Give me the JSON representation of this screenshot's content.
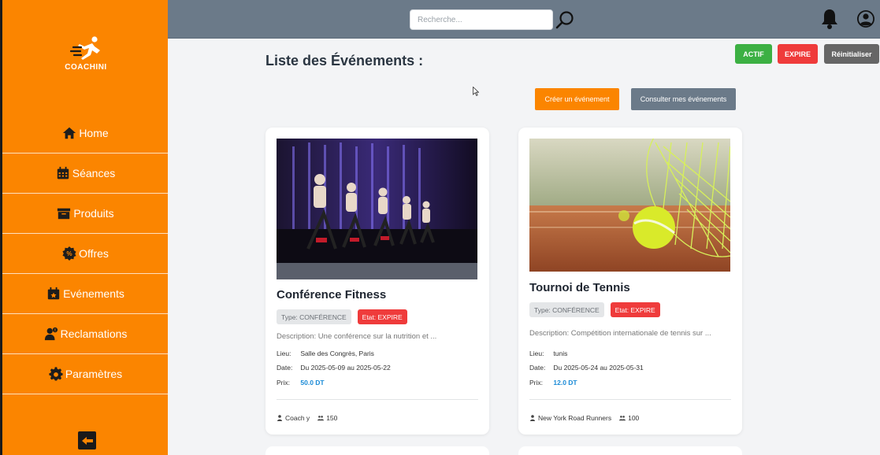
{
  "app": {
    "logo_text": "COACHINI"
  },
  "sidebar": {
    "items": [
      {
        "label": "Home",
        "icon": "home-icon"
      },
      {
        "label": "Séances",
        "icon": "calendar-icon"
      },
      {
        "label": "Produits",
        "icon": "box-icon"
      },
      {
        "label": "Offres",
        "icon": "discount-icon"
      },
      {
        "label": "Evénements",
        "icon": "event-icon"
      },
      {
        "label": "Reclamations",
        "icon": "user-alert-icon"
      },
      {
        "label": "Paramètres",
        "icon": "gear-icon"
      }
    ],
    "logout_icon": "logout-icon"
  },
  "header": {
    "search_placeholder": "Recherche..."
  },
  "main": {
    "title": "Liste des Événements :",
    "filters": {
      "actif": "ACTIF",
      "expire": "EXPIRE",
      "reset": "Réinitialiser"
    },
    "create_button": "Créer un événement",
    "consult_button": "Consulter mes événements",
    "labels": {
      "lieu": "Lieu:",
      "date": "Date:",
      "prix": "Prix:"
    },
    "events": [
      {
        "title": "Conférence Fitness",
        "type": "Type: CONFÉRENCE",
        "etat": "Etat: EXPIRE",
        "description": "Description: Une conférence sur la nutrition et ...",
        "lieu": "Salle des Congrès, Paris",
        "date": "Du 2025-05-09 au 2025-05-22",
        "prix": "50.0 DT",
        "organizer": "Coach y",
        "participants": "150"
      },
      {
        "title": "Tournoi de Tennis",
        "type": "Type: CONFÉRENCE",
        "etat": "Etat: EXPIRE",
        "description": "Description: Compétition internationale de tennis sur ...",
        "lieu": "tunis",
        "date": "Du 2025-05-24 au 2025-05-31",
        "prix": "12.0 DT",
        "organizer": "New York Road Runners",
        "participants": "100"
      }
    ]
  },
  "colors": {
    "sidebar": "#fb8500",
    "topbar": "#6b7a89",
    "actif": "#3cb043",
    "expire": "#ef3b3b",
    "price": "#1a8ad6"
  }
}
